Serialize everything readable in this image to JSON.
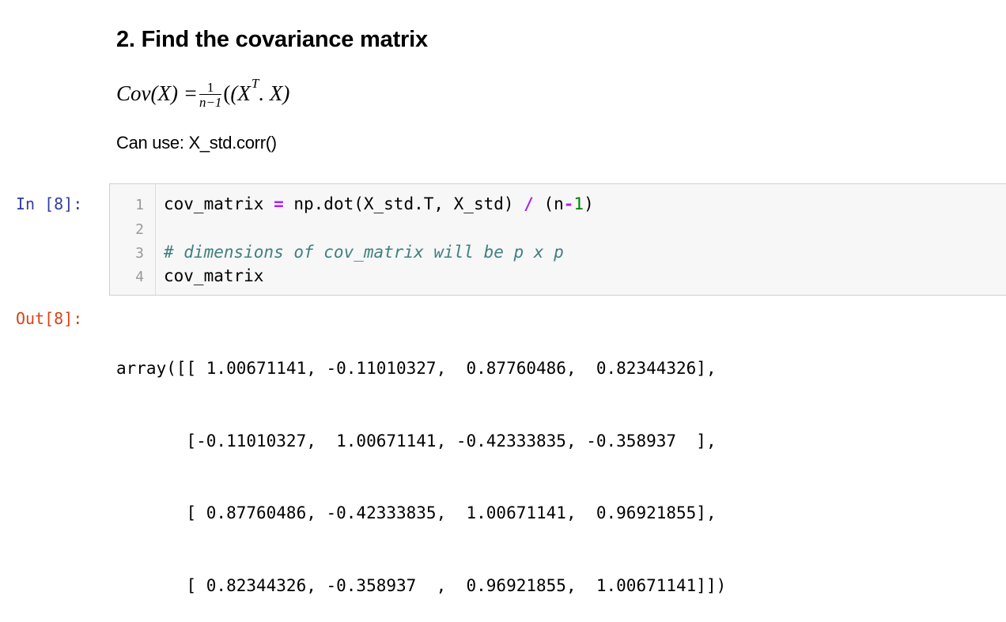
{
  "markdown": {
    "heading": "2. Find the covariance matrix",
    "formula": {
      "lhs": "Cov(X) =",
      "frac_num": "1",
      "frac_den": "n−1",
      "rhs_open": "(X",
      "rhs_sup": "T",
      "rhs_close": ". X)"
    },
    "note": "Can use: X_std.corr()"
  },
  "input_cell": {
    "prompt": "In [8]:",
    "line_numbers": [
      "1",
      "2",
      "3",
      "4"
    ],
    "line1": {
      "a": "cov_matrix ",
      "op1": "=",
      "b": " np.dot(X_std.T, X_std) ",
      "op2": "/",
      "c": " (n",
      "op3": "-",
      "num": "1",
      "d": ")"
    },
    "line3_comment": "# dimensions of cov_matrix will be p x p",
    "line4": "cov_matrix"
  },
  "output_cell": {
    "prompt": "Out[8]:",
    "lines": [
      "array([[ 1.00671141, -0.11010327,  0.87760486,  0.82344326],",
      "       [-0.11010327,  1.00671141, -0.42333835, -0.358937  ],",
      "       [ 0.87760486, -0.42333835,  1.00671141,  0.96921855],",
      "       [ 0.82344326, -0.358937  ,  0.96921855,  1.00671141]])"
    ]
  }
}
